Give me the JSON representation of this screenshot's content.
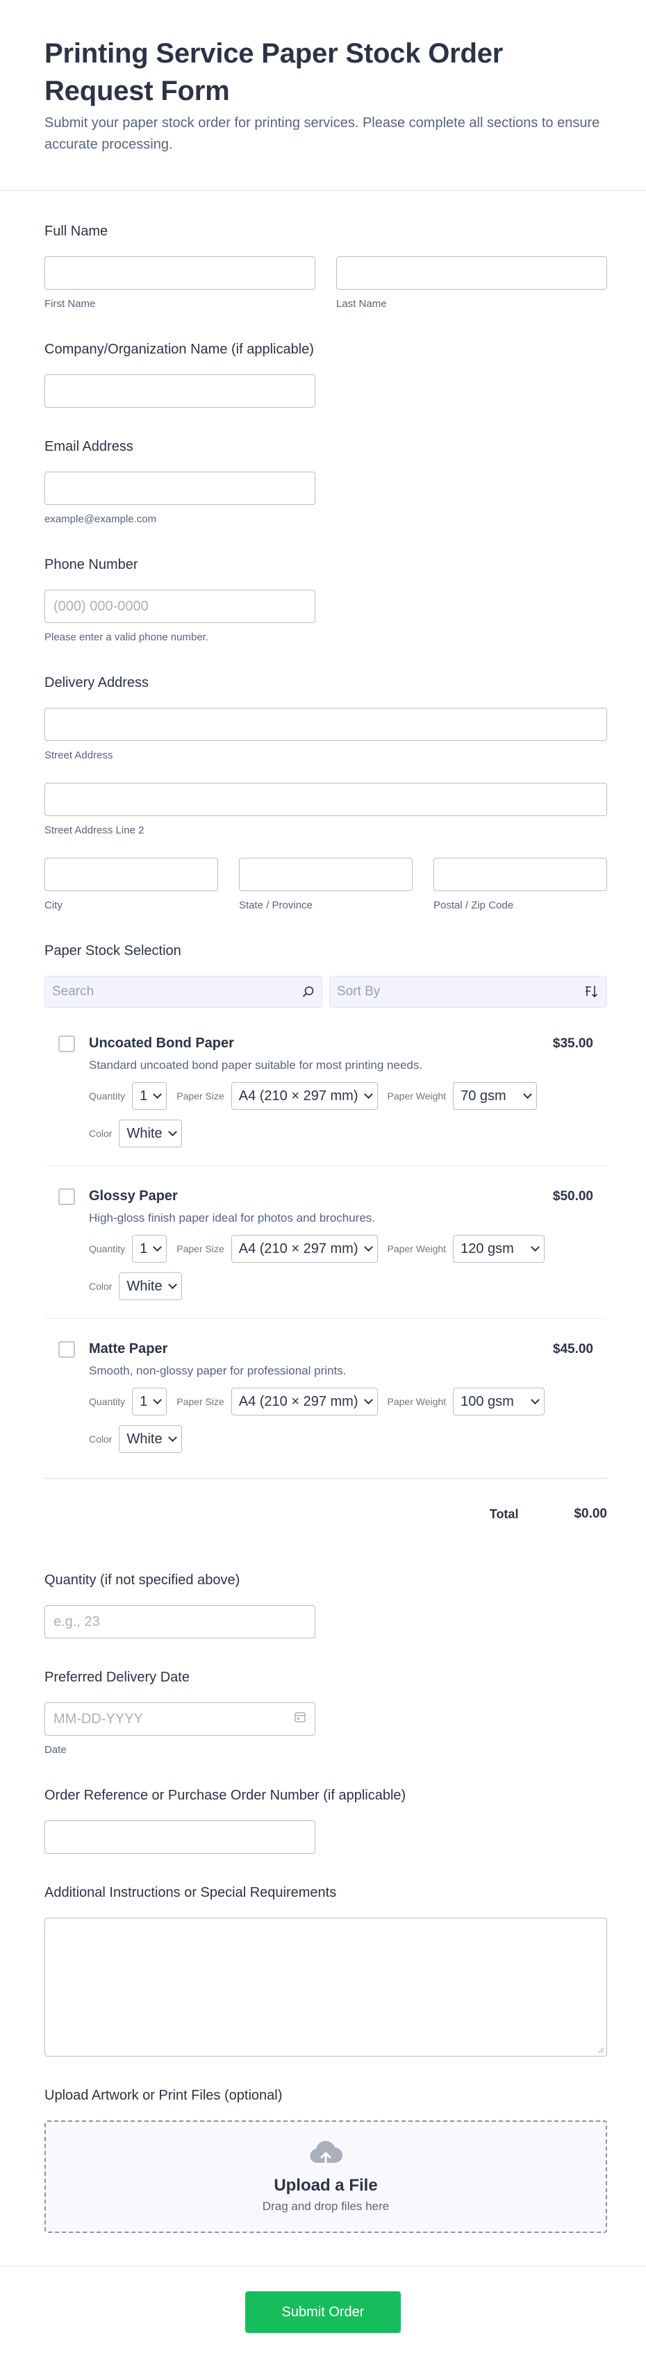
{
  "header": {
    "title": "Printing Service Paper Stock Order Request Form",
    "description": "Submit your paper stock order for printing services. Please complete all sections to ensure accurate processing."
  },
  "full_name": {
    "label": "Full Name",
    "first_sub": "First Name",
    "last_sub": "Last Name"
  },
  "company": {
    "label": "Company/Organization Name (if applicable)"
  },
  "email": {
    "label": "Email Address",
    "sub": "example@example.com"
  },
  "phone": {
    "label": "Phone Number",
    "placeholder": "(000) 000-0000",
    "sub": "Please enter a valid phone number."
  },
  "address": {
    "label": "Delivery Address",
    "street_sub": "Street Address",
    "street2_sub": "Street Address Line 2",
    "city_sub": "City",
    "state_sub": "State / Province",
    "zip_sub": "Postal / Zip Code"
  },
  "stock": {
    "label": "Paper Stock Selection",
    "search_placeholder": "Search",
    "sort_placeholder": "Sort By",
    "option_labels": {
      "quantity": "Quantity",
      "size": "Paper Size",
      "weight": "Paper Weight",
      "color": "Color"
    },
    "products": [
      {
        "name": "Uncoated Bond Paper",
        "price": "$35.00",
        "desc": "Standard uncoated bond paper suitable for most printing needs.",
        "quantity": "1",
        "size": "A4 (210 × 297 mm)",
        "weight": "70 gsm",
        "color": "White"
      },
      {
        "name": "Glossy Paper",
        "price": "$50.00",
        "desc": "High-gloss finish paper ideal for photos and brochures.",
        "quantity": "1",
        "size": "A4 (210 × 297 mm)",
        "weight": "120 gsm",
        "color": "White"
      },
      {
        "name": "Matte Paper",
        "price": "$45.00",
        "desc": "Smooth, non-glossy paper for professional prints.",
        "quantity": "1",
        "size": "A4 (210 × 297 mm)",
        "weight": "100 gsm",
        "color": "White"
      }
    ],
    "total_label": "Total",
    "total_value": "$0.00"
  },
  "quantity": {
    "label": "Quantity (if not specified above)",
    "placeholder": "e.g., 23"
  },
  "delivery_date": {
    "label": "Preferred Delivery Date",
    "placeholder": "MM-DD-YYYY",
    "sub": "Date"
  },
  "order_ref": {
    "label": "Order Reference or Purchase Order Number (if applicable)"
  },
  "instructions": {
    "label": "Additional Instructions or Special Requirements"
  },
  "upload": {
    "label": "Upload Artwork or Print Files (optional)",
    "title": "Upload a File",
    "subtitle": "Drag and drop files here"
  },
  "submit": {
    "label": "Submit Order"
  },
  "colors": {
    "accent": "#18bd5b",
    "text": "#2c3345",
    "muted": "#57647e",
    "border": "#b8bdc9",
    "toolbar_bg": "#f3f3fe"
  }
}
